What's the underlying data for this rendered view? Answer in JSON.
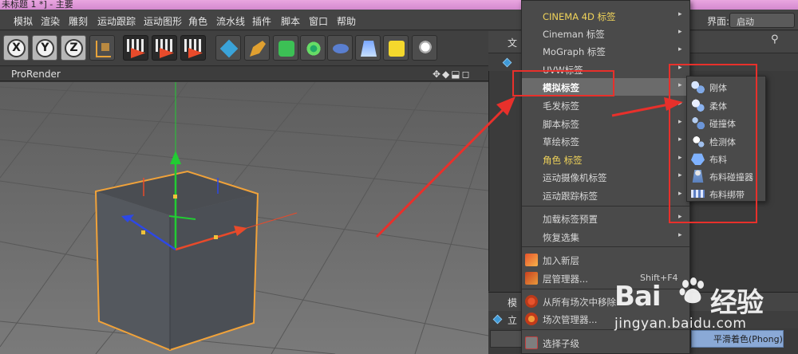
{
  "window": {
    "title": "未标题 1 *] - 主要"
  },
  "menubar": {
    "items": [
      "模拟",
      "渲染",
      "雕刻",
      "运动跟踪",
      "运动图形",
      "角色",
      "流水线",
      "插件",
      "脚本",
      "窗口",
      "帮助"
    ],
    "layout_label": "界面:",
    "layout_value": "启动"
  },
  "toolbar": {
    "axis_x": "X",
    "axis_y": "Y",
    "axis_z": "Z",
    "icons": [
      "world-axis-icon",
      "render-view-icon",
      "render-picture-viewer-icon",
      "render-settings-icon",
      "cube-icon",
      "pen-icon",
      "nurbs-icon",
      "mograph-flower-icon",
      "deformer-icon",
      "floor-icon",
      "camera-icon",
      "light-icon"
    ]
  },
  "viewport": {
    "name": "ProRender",
    "nav_icons": "✥◆⬓◻"
  },
  "object_panel": {
    "header_label": "文",
    "row_label": "立"
  },
  "attr_panel": {
    "header_label": "模",
    "row_label": "立",
    "phong_text": "平滑着色(Phong)"
  },
  "context_menu": {
    "items": [
      {
        "label": "CINEMA 4D 标签",
        "plugin": true,
        "submenu": true
      },
      {
        "label": "Cineman 标签",
        "plugin": false,
        "submenu": true
      },
      {
        "label": "MoGraph 标签",
        "plugin": false,
        "submenu": true
      },
      {
        "label": "UVW标签",
        "plugin": false,
        "submenu": true
      },
      {
        "label": "模拟标签",
        "plugin": false,
        "submenu": true,
        "highlighted": true
      },
      {
        "label": "毛发标签",
        "plugin": false,
        "submenu": true
      },
      {
        "label": "脚本标签",
        "plugin": false,
        "submenu": true
      },
      {
        "label": "草绘标签",
        "plugin": false,
        "submenu": true
      },
      {
        "label": "角色 标签",
        "plugin": true,
        "submenu": true
      },
      {
        "label": "运动摄像机标签",
        "plugin": false,
        "submenu": true
      },
      {
        "label": "运动跟踪标签",
        "plugin": false,
        "submenu": true
      }
    ],
    "items2": [
      {
        "label": "加载标签预置",
        "submenu": true
      },
      {
        "label": "恢复选集",
        "submenu": true
      }
    ],
    "items3": [
      {
        "label": "加入新层",
        "icon": "add-layer-icon"
      },
      {
        "label": "层管理器...",
        "icon": "layer-manager-icon",
        "shortcut": "Shift+F4"
      }
    ],
    "items4": [
      {
        "label": "从所有场次中移除",
        "icon": "remove-from-takes-icon"
      },
      {
        "label": "场次管理器...",
        "icon": "take-manager-icon"
      }
    ],
    "items5": [
      {
        "label": "选择子级",
        "icon": "select-children-icon"
      }
    ],
    "arrow": "▸"
  },
  "submenu": {
    "items": [
      {
        "label": "刚体",
        "icon": "rigid-body-icon"
      },
      {
        "label": "柔体",
        "icon": "soft-body-icon"
      },
      {
        "label": "碰撞体",
        "icon": "collider-body-icon"
      },
      {
        "label": "检测体",
        "icon": "ghost-body-icon"
      },
      {
        "label": "布料",
        "icon": "cloth-icon"
      },
      {
        "label": "布料碰撞器",
        "icon": "cloth-collider-icon"
      },
      {
        "label": "布料绑带",
        "icon": "cloth-belt-icon"
      }
    ]
  },
  "watermark": {
    "bai": "Bai",
    "du": "经验",
    "url": "jingyan.baidu.com"
  },
  "colors": {
    "annotation_red": "#e8302b",
    "cube_outline": "#f0a23a",
    "axis_x": "#e84a2b",
    "axis_y": "#22cc33",
    "axis_z": "#2d48e6"
  }
}
